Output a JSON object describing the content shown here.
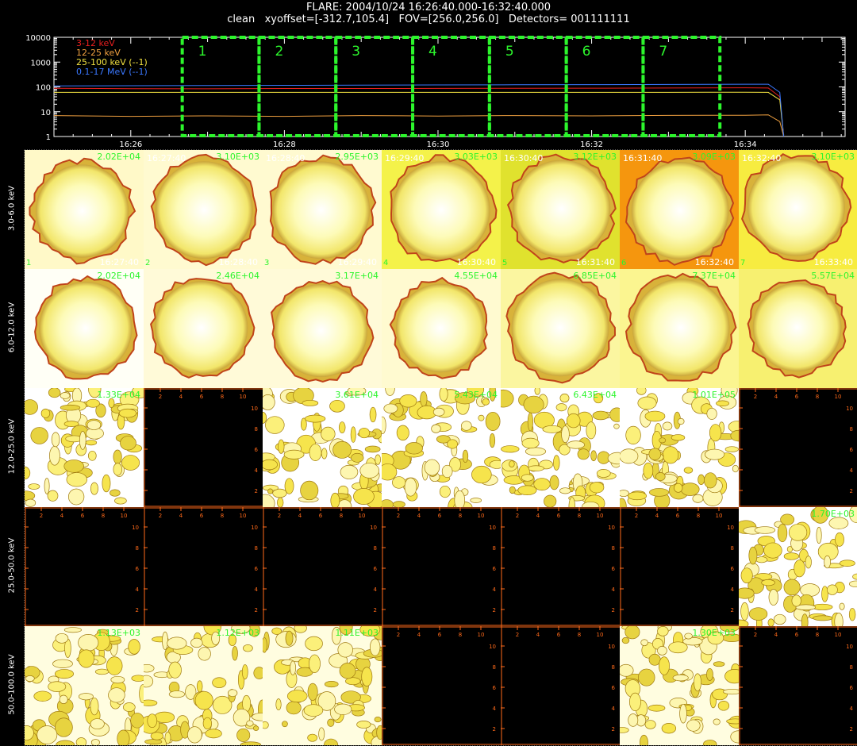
{
  "header": {
    "line1": "FLARE: 2004/10/24 16:26:40.000-16:32:40.000",
    "line2": "clean   xyoffset=[-312.7,105.4]   FOV=[256.0,256.0]   Detectors= 001111111"
  },
  "colors": {
    "accent_green": "#2cf52c",
    "axis_orange": "#ff6a1a"
  },
  "chart_data": [
    {
      "type": "line",
      "yscale": "log",
      "ylim": [
        1,
        10000
      ],
      "yticks": [
        "10000",
        "1000",
        "100",
        "10",
        "1"
      ],
      "xticks": [
        "16:26",
        "16:28",
        "16:30",
        "16:32",
        "16:34"
      ],
      "x_range_minutes": [
        25.0,
        35.3
      ],
      "legend": [
        {
          "label": "3-12 keV",
          "color": "#e81e1e"
        },
        {
          "label": "12-25 keV",
          "color": "#f0a040"
        },
        {
          "label": "25-100 keV (--1)",
          "color": "#f0e040"
        },
        {
          "label": "0.1-17 MeV (--1)",
          "color": "#3a78ff"
        }
      ],
      "series": [
        {
          "name": "3-12 keV",
          "color": "#e81e1e",
          "x": [
            25.0,
            26.0,
            27.0,
            28.0,
            29.0,
            30.0,
            31.0,
            32.0,
            33.0,
            34.0,
            34.3,
            34.45,
            34.5
          ],
          "values": [
            88,
            85,
            84,
            86,
            86,
            87,
            88,
            89,
            90,
            92,
            90,
            40,
            1
          ]
        },
        {
          "name": "12-25 keV",
          "color": "#f0a040",
          "x": [
            25.0,
            26.0,
            27.0,
            28.0,
            29.0,
            30.0,
            31.0,
            32.0,
            33.0,
            34.0,
            34.3,
            34.45,
            34.5
          ],
          "values": [
            7,
            6.5,
            6.8,
            6.5,
            7,
            6.7,
            7,
            6.8,
            7.1,
            7.2,
            7.5,
            4,
            1
          ]
        },
        {
          "name": "25-100 keV (--1)",
          "color": "#f0e040",
          "x": [
            25.0,
            26.0,
            27.0,
            28.0,
            29.0,
            30.0,
            31.0,
            32.0,
            33.0,
            34.0,
            34.3,
            34.45,
            34.5
          ],
          "values": [
            60,
            60,
            60,
            60,
            60,
            60,
            60,
            60,
            60,
            61,
            60,
            30,
            1
          ]
        },
        {
          "name": "0.1-17 MeV (--1)",
          "color": "#3a78ff",
          "x": [
            25.0,
            26.0,
            27.0,
            28.0,
            29.0,
            30.0,
            31.0,
            32.0,
            33.0,
            34.0,
            34.3,
            34.45,
            34.5
          ],
          "values": [
            110,
            112,
            114,
            116,
            118,
            120,
            122,
            124,
            126,
            128,
            128,
            60,
            1
          ]
        }
      ],
      "intervals": [
        {
          "label": "1",
          "start": 26.67,
          "end": 27.67
        },
        {
          "label": "2",
          "start": 27.67,
          "end": 28.67
        },
        {
          "label": "3",
          "start": 28.67,
          "end": 29.67
        },
        {
          "label": "4",
          "start": 29.67,
          "end": 30.67
        },
        {
          "label": "5",
          "start": 30.67,
          "end": 31.67
        },
        {
          "label": "6",
          "start": 31.67,
          "end": 32.67
        },
        {
          "label": "7",
          "start": 32.67,
          "end": 33.67
        }
      ]
    },
    {
      "type": "heatmap",
      "row_labels": [
        "3.0-6.0 keV",
        "6.0-12.0 keV",
        "12.0-25.0 keV",
        "25.0-50.0 keV",
        "50.0-100.0 keV"
      ],
      "interval_numbers": [
        "1",
        "2",
        "3",
        "4",
        "5",
        "6",
        "7"
      ],
      "cell_times": [
        "16:26:40",
        "16:27:40",
        "16:28:40",
        "16:29:40",
        "16:30:40",
        "16:31:40",
        "16:32:40",
        "16:33:40"
      ],
      "axis_ticks": [
        "2",
        "4",
        "6",
        "8",
        "10"
      ],
      "rows": [
        [
          {
            "peak": "2.02E+04",
            "kind": "disk",
            "disk_radius": 0.42,
            "bg": "#fff9c8"
          },
          {
            "peak": "3.10E+03",
            "kind": "disk",
            "disk_radius": 0.44,
            "bg": "#fffad0"
          },
          {
            "peak": "2.95E+03",
            "kind": "disk",
            "disk_radius": 0.44,
            "bg": "#fffad0"
          },
          {
            "peak": "3.03E+03",
            "kind": "disk",
            "disk_radius": 0.44,
            "bg": "#f4f24a"
          },
          {
            "peak": "3.12E+03",
            "kind": "disk",
            "disk_radius": 0.44,
            "bg": "#e0e22e"
          },
          {
            "peak": "3.09E+03",
            "kind": "disk",
            "disk_radius": 0.44,
            "bg": "#f5960e"
          },
          {
            "peak": "3.10E+03",
            "kind": "disk",
            "disk_radius": 0.44,
            "bg": "#f7ec40"
          }
        ],
        [
          {
            "peak": "2.02E+04",
            "kind": "disk",
            "disk_radius": 0.42,
            "bg": "#fffff6"
          },
          {
            "peak": "2.46E+04",
            "kind": "disk",
            "disk_radius": 0.42,
            "bg": "#fffad8"
          },
          {
            "peak": "3.17E+04",
            "kind": "disk",
            "disk_radius": 0.42,
            "bg": "#fffad8"
          },
          {
            "peak": "4.55E+04",
            "kind": "disk",
            "disk_radius": 0.4,
            "bg": "#fffad0"
          },
          {
            "peak": "6.85E+04",
            "kind": "disk",
            "disk_radius": 0.44,
            "bg": "#fbf6a0"
          },
          {
            "peak": "7.37E+04",
            "kind": "disk",
            "disk_radius": 0.44,
            "bg": "#fbf590"
          },
          {
            "peak": "5.57E+04",
            "kind": "disk",
            "disk_radius": 0.4,
            "bg": "#f7f070"
          }
        ],
        [
          {
            "peak": "1.33E+04",
            "kind": "speckle",
            "bg": "#ffffff"
          },
          {
            "peak": "",
            "kind": "blank"
          },
          {
            "peak": "3.61E+04",
            "kind": "speckle",
            "bg": "#ffffff"
          },
          {
            "peak": "5.43E+04",
            "kind": "speckle",
            "bg": "#ffffff"
          },
          {
            "peak": "6.43E+04",
            "kind": "speckle",
            "bg": "#ffffff"
          },
          {
            "peak": "1.01E+05",
            "kind": "speckle",
            "bg": "#ffffff"
          },
          {
            "peak": "",
            "kind": "blank"
          }
        ],
        [
          {
            "peak": "",
            "kind": "blank"
          },
          {
            "peak": "",
            "kind": "blank"
          },
          {
            "peak": "",
            "kind": "blank"
          },
          {
            "peak": "",
            "kind": "blank"
          },
          {
            "peak": "",
            "kind": "blank"
          },
          {
            "peak": "",
            "kind": "blank"
          },
          {
            "peak": "1.70E+03",
            "kind": "speckle",
            "bg": "#ffffff"
          }
        ],
        [
          {
            "peak": "1.13E+03",
            "kind": "speckle",
            "bg": "#fffde0"
          },
          {
            "peak": "1.12E+03",
            "kind": "speckle",
            "bg": "#fffde0"
          },
          {
            "peak": "1.11E+03",
            "kind": "speckle",
            "bg": "#fffde0"
          },
          {
            "peak": "",
            "kind": "blank"
          },
          {
            "peak": "",
            "kind": "blank"
          },
          {
            "peak": "1.30E+03",
            "kind": "speckle",
            "bg": "#fffde0"
          },
          {
            "peak": "",
            "kind": "blank"
          }
        ]
      ]
    }
  ]
}
